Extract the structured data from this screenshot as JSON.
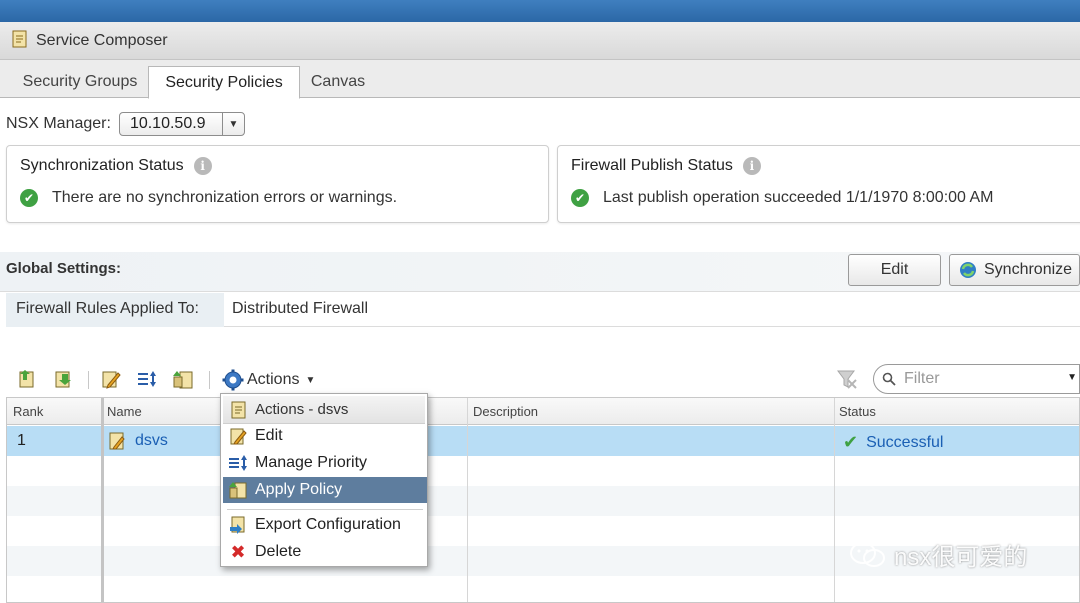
{
  "window": {
    "title": "Service Composer"
  },
  "tabs": [
    {
      "label": "Security Groups"
    },
    {
      "label": "Security Policies"
    },
    {
      "label": "Canvas"
    }
  ],
  "nsx_manager": {
    "label": "NSX Manager:",
    "value": "10.10.50.9"
  },
  "sync_status": {
    "title": "Synchronization Status",
    "message": "There are no synchronization errors or warnings."
  },
  "firewall_status": {
    "title": "Firewall Publish Status",
    "message": "Last publish operation succeeded 1/1/1970 8:00:00 AM"
  },
  "global_settings": {
    "label": "Global Settings:",
    "edit_label": "Edit",
    "sync_label": "Synchronize",
    "firewall_key": "Firewall Rules Applied To:",
    "firewall_value": "Distributed Firewall"
  },
  "toolbar": {
    "actions_label": "Actions",
    "filter_placeholder": "Filter"
  },
  "table": {
    "columns": [
      "Rank",
      "Name",
      "Description",
      "Status"
    ],
    "rows": [
      {
        "rank": "1",
        "name": "dsvs",
        "description": "",
        "status": "Successful"
      }
    ]
  },
  "context_menu": {
    "header": "Actions - dsvs",
    "items": [
      {
        "label": "Edit"
      },
      {
        "label": "Manage Priority"
      },
      {
        "label": "Apply Policy"
      },
      {
        "label": "Export Configuration"
      },
      {
        "label": "Delete"
      }
    ]
  },
  "watermark": {
    "text": "nsx很可爱的"
  },
  "colors": {
    "accent": "#2b67a6",
    "selection": "#b8ddf5",
    "menu_highlight": "#5e7d9e",
    "success": "#3fa143",
    "link": "#1a5fb4"
  }
}
